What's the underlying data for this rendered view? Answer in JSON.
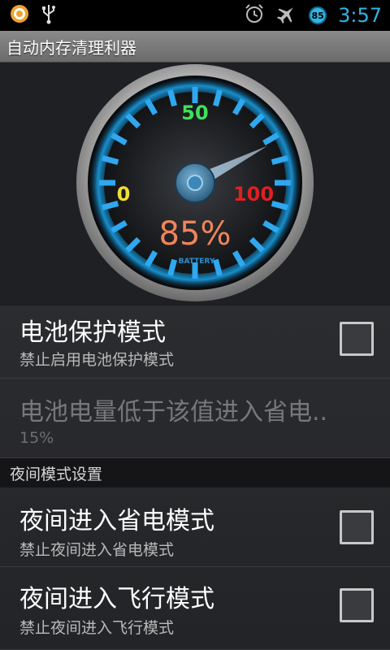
{
  "status_bar": {
    "clock": "3:57",
    "battery_level": "85",
    "icons": [
      "app-notification-icon",
      "usb-icon",
      "alarm-icon",
      "airplane-mode-icon",
      "battery-badge-icon"
    ],
    "accent_color": "#33b5e5"
  },
  "app": {
    "title": "自动内存清理利器"
  },
  "gauge": {
    "label_min": "0",
    "label_mid": "50",
    "label_max": "100",
    "percent_text": "85%",
    "caption": "BATTERY",
    "level": 85
  },
  "settings": {
    "battery_protect": {
      "title": "电池保护模式",
      "summary": "禁止启用电池保护模式",
      "checked": false
    },
    "low_battery_threshold": {
      "title": "电池电量低于该值进入省电..",
      "summary": "15%"
    },
    "night_section": {
      "header": "夜间模式设置"
    },
    "night_power_save": {
      "title": "夜间进入省电模式",
      "summary": "禁止夜间进入省电模式",
      "checked": false
    },
    "night_airplane": {
      "title": "夜间进入飞行模式",
      "summary": "禁止夜间进入飞行模式",
      "checked": false
    }
  }
}
